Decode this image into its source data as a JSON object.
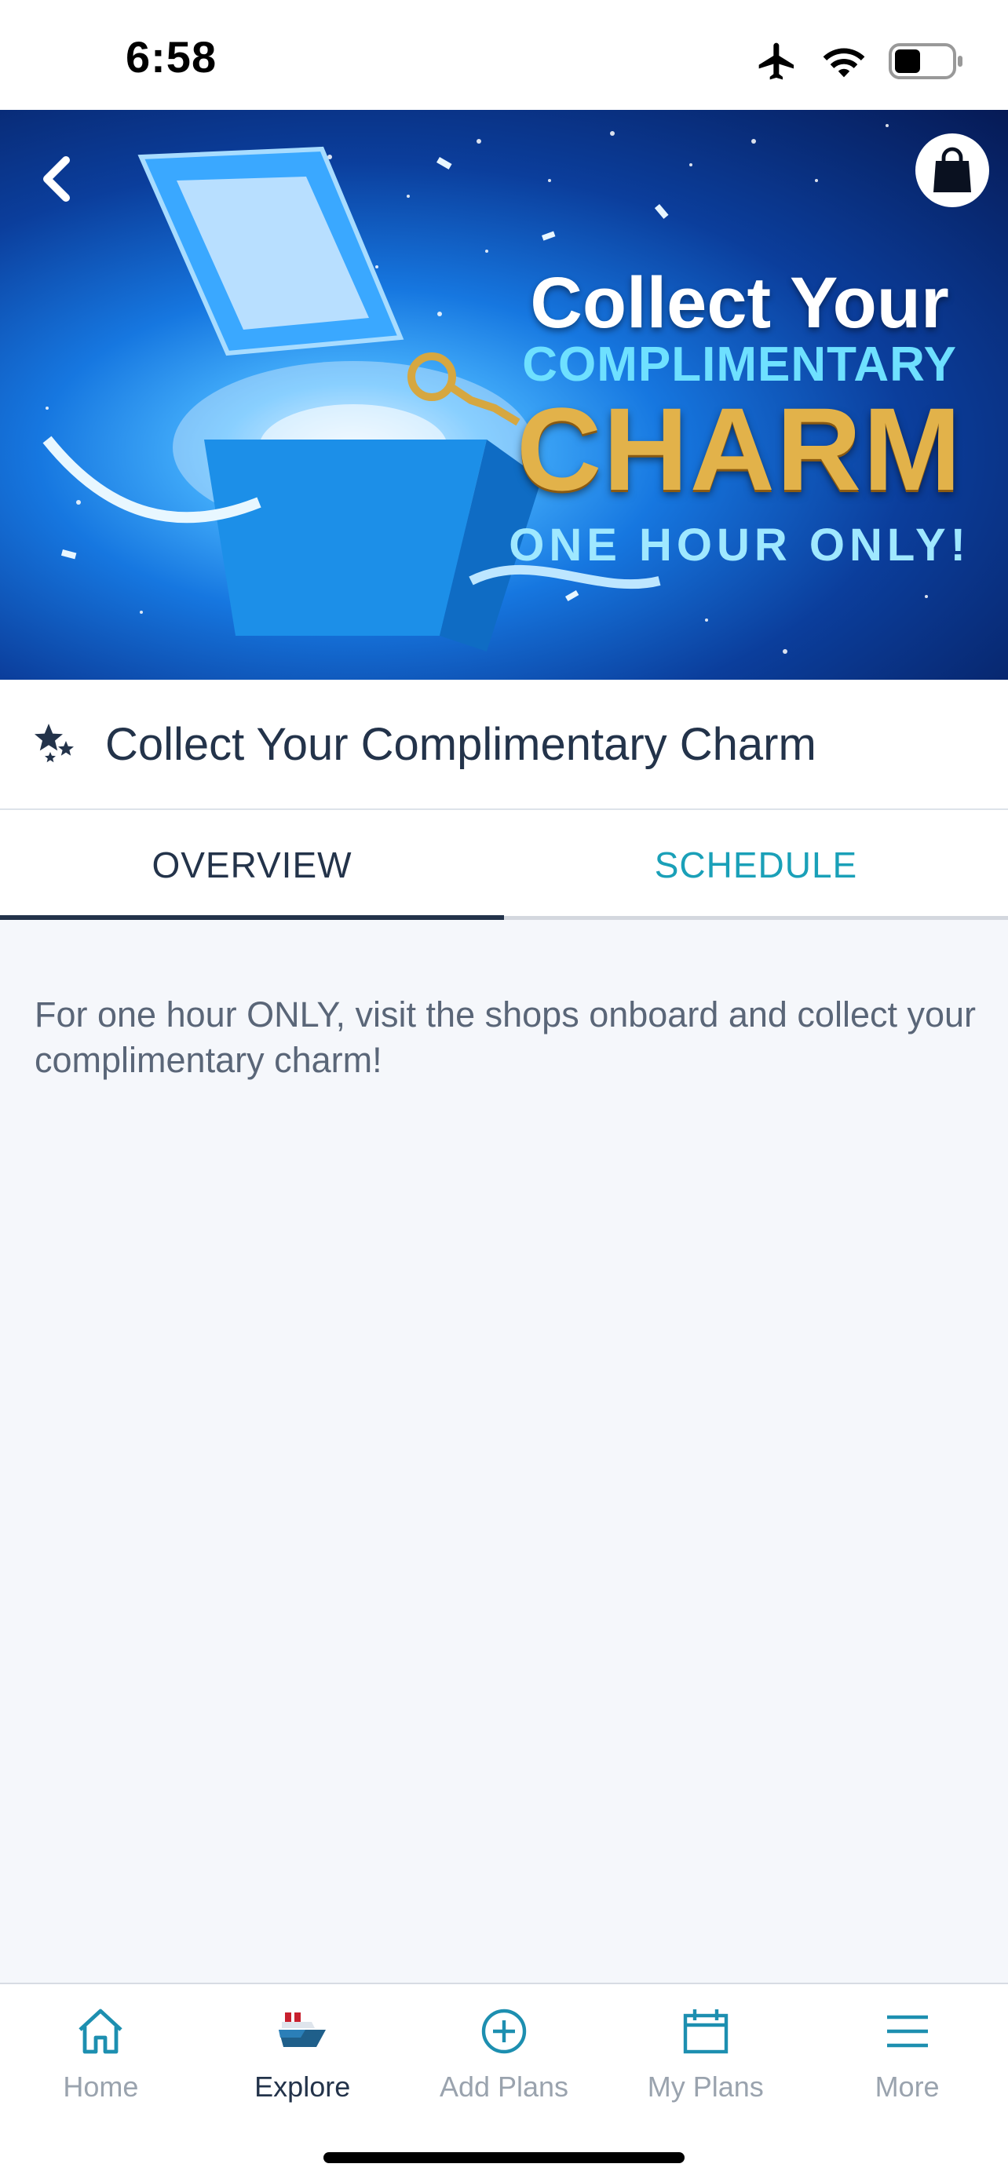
{
  "status_bar": {
    "time": "6:58",
    "icons": [
      "airplane-icon",
      "wifi-icon",
      "battery-icon"
    ]
  },
  "hero": {
    "line1": "Collect Your",
    "line2": "COMPLIMENTARY",
    "line3": "CHARM",
    "line4": "ONE HOUR ONLY!",
    "icons": [
      "back-chevron-icon",
      "shopping-bag-icon"
    ]
  },
  "title": {
    "text": "Collect Your Complimentary Charm",
    "icon": "stars-icon"
  },
  "tabs": [
    {
      "label": "OVERVIEW",
      "active": true
    },
    {
      "label": "SCHEDULE",
      "active": false
    }
  ],
  "content": {
    "description": "For one hour ONLY, visit the shops onboard and collect your complimentary charm!"
  },
  "nav": {
    "items": [
      {
        "label": "Home",
        "icon": "home-icon",
        "active": false
      },
      {
        "label": "Explore",
        "icon": "ship-icon",
        "active": true
      },
      {
        "label": "Add Plans",
        "icon": "plus-circle-icon",
        "active": false
      },
      {
        "label": "My Plans",
        "icon": "calendar-icon",
        "active": false
      },
      {
        "label": "More",
        "icon": "menu-icon",
        "active": false
      }
    ]
  },
  "colors": {
    "primary": "#23334a",
    "accent": "#1aa0b8",
    "icon": "#1d8fb0",
    "background": "#f5f7fb"
  }
}
